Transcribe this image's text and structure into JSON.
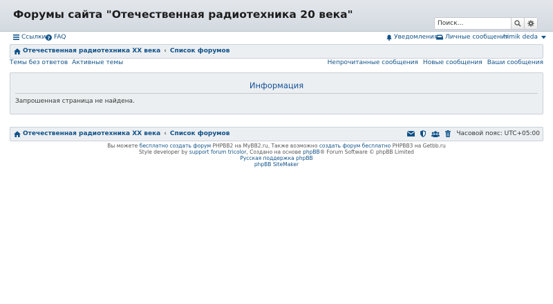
{
  "header": {
    "site_title": "Форумы сайта \"Отечественная радиотехника 20 века\"",
    "search_placeholder": "Поиск…",
    "search_icon": "search-icon",
    "advanced_search_icon": "gear-icon"
  },
  "nav": {
    "links_label": "Ссылки",
    "faq_label": "FAQ",
    "notifications_label": "Уведомления",
    "pm_label": "Личные сообщения",
    "username": "himik deda"
  },
  "breadcrumb": {
    "home_label": "Отечественная радиотехника XX века",
    "separator": "‹",
    "forums_label": "Список форумов"
  },
  "quick_links": {
    "left": [
      "Темы без ответов",
      "Активные темы"
    ],
    "right": [
      "Непрочитанные сообщения",
      "Новые сообщения",
      "Ваши сообщения"
    ]
  },
  "info": {
    "title": "Информация",
    "message": "Запрошенная страница не найдена."
  },
  "bottom_bar": {
    "timezone": "Часовой пояс: UTC+05:00"
  },
  "footer": {
    "line1_a": "Вы можете ",
    "line1_link1": "бесплатно создать форум",
    "line1_b": " PHPBB2 на MyBB2.ru, Также возможно ",
    "line1_link2": "создать форум бесплатно",
    "line1_c": " PHPBB3 на Getbb.ru",
    "line2_a": "Style developer by ",
    "line2_link1": "support forum tricolor",
    "line2_b": ", Создано на основе ",
    "line2_link2": "phpBB",
    "line2_c": "® Forum Software © phpBB Limited",
    "line3": "Русская поддержка phpBB",
    "line4": "phpBB SiteMaker"
  },
  "colors": {
    "link": "#105289",
    "header_bg": "#d8dee5",
    "panel_bg": "#eceff1"
  }
}
